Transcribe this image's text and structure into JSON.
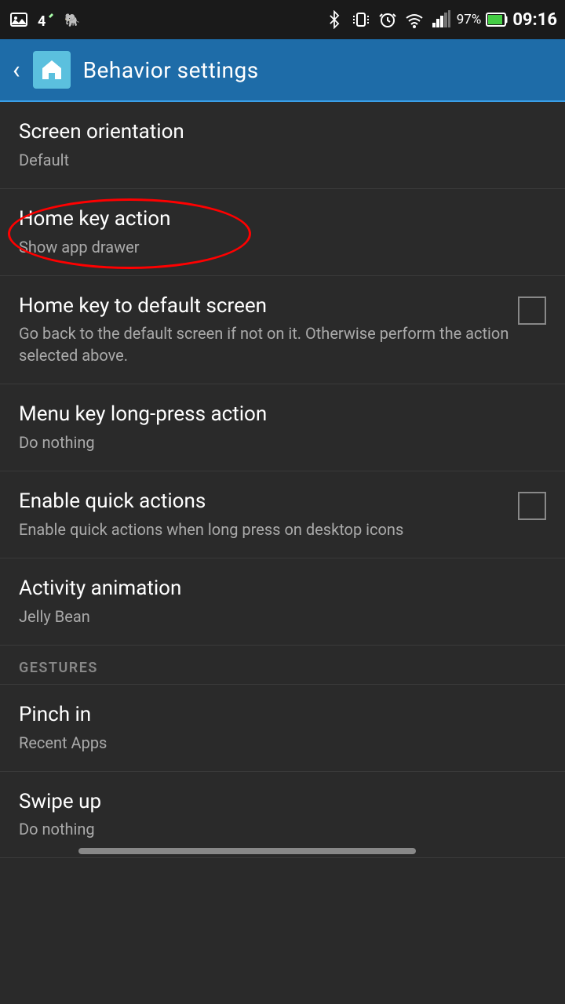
{
  "statusBar": {
    "time": "09:16",
    "battery": "97%",
    "icons": [
      "image",
      "signal",
      "elephant",
      "bluetooth",
      "phone",
      "alarm",
      "wifi",
      "signal-bars"
    ]
  },
  "actionBar": {
    "backLabel": "‹",
    "title": "Behavior settings"
  },
  "settings": [
    {
      "id": "screen-orientation",
      "title": "Screen orientation",
      "subtitle": "Default",
      "hasCheckbox": false,
      "highlighted": false
    },
    {
      "id": "home-key-action",
      "title": "Home key action",
      "subtitle": "Show app drawer",
      "hasCheckbox": false,
      "highlighted": true
    },
    {
      "id": "home-key-default-screen",
      "title": "Home key to default screen",
      "subtitle": "Go back to the default screen if not on it. Otherwise perform the action selected above.",
      "hasCheckbox": true,
      "checked": false,
      "highlighted": false
    },
    {
      "id": "menu-key-long-press",
      "title": "Menu key long-press action",
      "subtitle": "Do nothing",
      "hasCheckbox": false,
      "highlighted": false
    },
    {
      "id": "enable-quick-actions",
      "title": "Enable quick actions",
      "subtitle": "Enable quick actions when long press on desktop icons",
      "hasCheckbox": true,
      "checked": false,
      "highlighted": false
    },
    {
      "id": "activity-animation",
      "title": "Activity animation",
      "subtitle": "Jelly Bean",
      "hasCheckbox": false,
      "highlighted": false
    }
  ],
  "gestures": {
    "header": "GESTURES",
    "items": [
      {
        "id": "pinch-in",
        "title": "Pinch in",
        "subtitle": "Recent Apps",
        "hasCheckbox": false
      },
      {
        "id": "swipe-up",
        "title": "Swipe up",
        "subtitle": "Do nothing",
        "hasCheckbox": false,
        "truncated": true
      }
    ]
  }
}
